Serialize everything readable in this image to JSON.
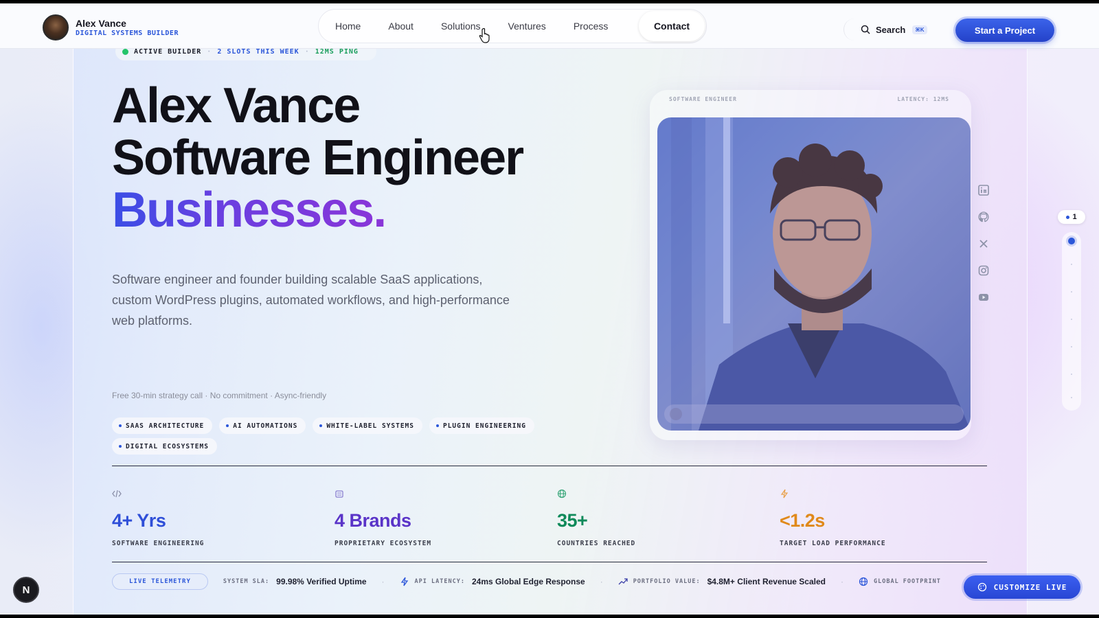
{
  "brand": {
    "name": "Alex Vance",
    "subtitle": "DIGITAL SYSTEMS BUILDER"
  },
  "nav": {
    "links": [
      "Home",
      "About",
      "Solutions",
      "Ventures",
      "Process"
    ],
    "active": "Contact",
    "search_label": "Search",
    "search_shortcut": "⌘K",
    "cta": "Start a Project"
  },
  "status": {
    "state": "ACTIVE BUILDER",
    "slots": "2 SLOTS THIS WEEK",
    "ping": "12MS PING"
  },
  "hero": {
    "line1": "Alex Vance",
    "line2": "Software Engineer",
    "line3": "Businesses.",
    "description": "Software engineer and founder building scalable SaaS applications, custom WordPress plugins, automated workflows, and high-performance web platforms.",
    "fine_print": "Free 30-min strategy call · No commitment · Async-friendly",
    "tags": [
      "SAAS ARCHITECTURE",
      "AI AUTOMATIONS",
      "WHITE-LABEL SYSTEMS",
      "PLUGIN ENGINEERING",
      "DIGITAL ECOSYSTEMS"
    ]
  },
  "portrait": {
    "label_left": "SOFTWARE ENGINEER",
    "label_right": "LATENCY: 12MS"
  },
  "social": [
    "linkedin-icon",
    "github-icon",
    "x-icon",
    "instagram-icon",
    "youtube-icon"
  ],
  "page_indicator": "1",
  "stats": [
    {
      "icon": "code-icon",
      "value": "4+ Yrs",
      "label": "SOFTWARE ENGINEERING",
      "color": "#2f4fd8"
    },
    {
      "icon": "building-icon",
      "value": "4 Brands",
      "label": "PROPRIETARY ECOSYSTEM",
      "color": "#5a34c8"
    },
    {
      "icon": "globe-icon",
      "value": "35+",
      "label": "COUNTRIES REACHED",
      "color": "#0f8a5a"
    },
    {
      "icon": "bolt-icon",
      "value": "<1.2s",
      "label": "TARGET LOAD PERFORMANCE",
      "color": "#e0891a"
    }
  ],
  "telemetry": {
    "pill": "LIVE TELEMETRY",
    "items": [
      {
        "key": "SYSTEM SLA:",
        "value": "99.98% Verified Uptime"
      },
      {
        "key": "API LATENCY:",
        "value": "24ms Global Edge Response"
      },
      {
        "key": "PORTFOLIO VALUE:",
        "value": "$4.8M+ Client Revenue Scaled"
      },
      {
        "key": "GLOBAL FOOTPRINT",
        "value": ""
      }
    ]
  },
  "customize_label": "CUSTOMIZE LIVE",
  "dev_badge": "N"
}
